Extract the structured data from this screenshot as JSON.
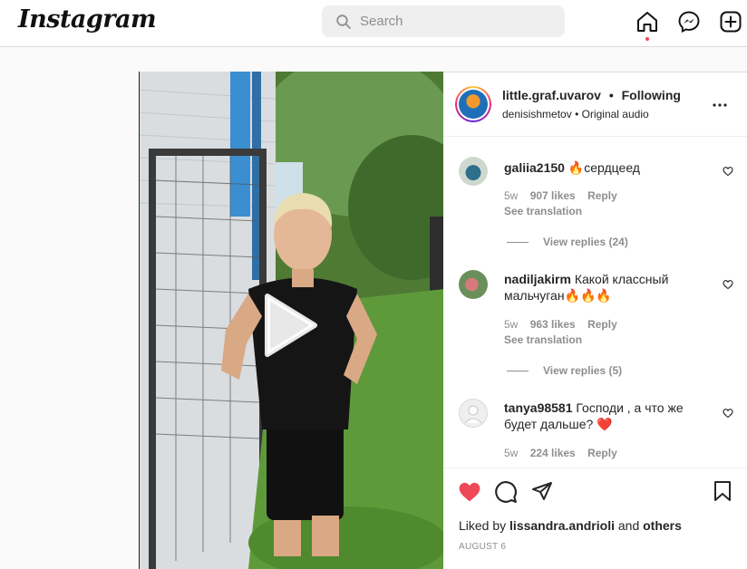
{
  "nav": {
    "logo": "Instagram",
    "search_placeholder": "Search",
    "icons": [
      "home-icon",
      "messenger-icon",
      "new-post-icon"
    ]
  },
  "post": {
    "username": "little.graf.uvarov",
    "separator": "•",
    "follow_status": "Following",
    "audio_artist": "denisishmetov",
    "audio_sep": "•",
    "audio_label": "Original audio",
    "comments": [
      {
        "user": "galiia2150",
        "text": "🔥сердцеед",
        "age": "5w",
        "likes": "907 likes",
        "reply": "Reply",
        "translation": "See translation",
        "view_replies": "View replies (24)"
      },
      {
        "user": "nadiljakirm",
        "text": "Какой классный мальчуган🔥🔥🔥",
        "age": "5w",
        "likes": "963 likes",
        "reply": "Reply",
        "translation": "See translation",
        "view_replies": "View replies (5)"
      },
      {
        "user": "tanya98581",
        "text": "Господи , а что же будет дальше? ❤️",
        "age": "5w",
        "likes": "224 likes",
        "reply": "Reply"
      }
    ],
    "liked_prefix": "Liked by",
    "liked_user": "lissandra.andrioli",
    "liked_and": "and",
    "liked_others": "others",
    "date": "AUGUST 6"
  },
  "colors": {
    "like_red": "#ed4956",
    "text": "#262626",
    "muted": "#8e8e8e",
    "border": "#dbdbdb"
  }
}
